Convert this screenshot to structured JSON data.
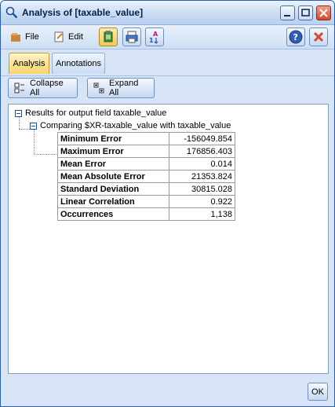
{
  "window": {
    "title": "Analysis of [taxable_value]"
  },
  "menu": {
    "file_label": "File",
    "edit_label": "Edit"
  },
  "toolbar_icons": [
    "clipboard-icon",
    "print-icon",
    "sort-az-icon",
    "help-icon",
    "close-red-icon"
  ],
  "tabs": [
    {
      "label": "Analysis",
      "active": true
    },
    {
      "label": "Annotations",
      "active": false
    }
  ],
  "actions": {
    "collapse_label": "Collapse All",
    "expand_label": "Expand All"
  },
  "tree": {
    "root_label": "Results for output field taxable_value",
    "child_label": "Comparing $XR-taxable_value with taxable_value",
    "rows": [
      {
        "name": "Minimum Error",
        "value": "-156049.854"
      },
      {
        "name": "Maximum Error",
        "value": "176856.403"
      },
      {
        "name": "Mean Error",
        "value": "0.014"
      },
      {
        "name": "Mean Absolute Error",
        "value": "21353.824"
      },
      {
        "name": "Standard Deviation",
        "value": "30815.028"
      },
      {
        "name": "Linear Correlation",
        "value": "0.922"
      },
      {
        "name": "Occurrences",
        "value": "1,138"
      }
    ]
  },
  "footer": {
    "ok_label": "OK"
  },
  "colors": {
    "accent_blue": "#1f4e9e",
    "close_red": "#d2482b",
    "tab_active": "#f8d56c"
  }
}
